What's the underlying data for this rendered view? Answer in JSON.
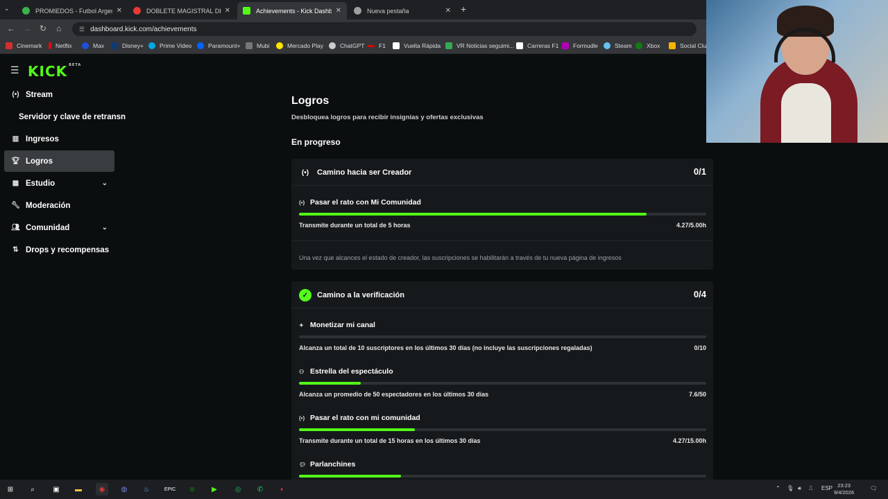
{
  "browser": {
    "tabs": [
      {
        "title": "PROMIEDOS - Futbol Argentino",
        "color": "#3bb34a"
      },
      {
        "title": "DOBLETE MAGISTRAL DE WATK",
        "color": "#e53935"
      },
      {
        "title": "Achievements - Kick Dashboard",
        "color": "#53fc18",
        "active": true
      },
      {
        "title": "Nueva pestaña",
        "color": "#9e9e9e"
      }
    ],
    "url": "dashboard.kick.com/achievements",
    "bookmarks": [
      {
        "label": "Cinemark",
        "color": "#d32f2f"
      },
      {
        "label": "Netflix",
        "color": "#e50914"
      },
      {
        "label": "Max",
        "color": "#1f4ed8"
      },
      {
        "label": "Disney+",
        "color": "#0e3b73"
      },
      {
        "label": "Prime Video",
        "color": "#00a8e1"
      },
      {
        "label": "Paramount+",
        "color": "#0064ff"
      },
      {
        "label": "Mubi",
        "color": "#777777"
      },
      {
        "label": "Mercado Play",
        "color": "#ffe600"
      },
      {
        "label": "ChatGPT",
        "color": "#cccccc"
      },
      {
        "label": "F1",
        "color": "#e10600"
      },
      {
        "label": "Vuelta Rápida",
        "color": "#ffffff"
      },
      {
        "label": "VR Noticias seguimi...",
        "color": "#34a853"
      },
      {
        "label": "Carreras F1",
        "color": "#ffffff"
      },
      {
        "label": "Formudle",
        "color": "#b000b5"
      },
      {
        "label": "Steam",
        "color": "#66c0f4"
      },
      {
        "label": "Xbox",
        "color": "#107c10"
      },
      {
        "label": "Social Club",
        "color": "#f7b500"
      }
    ]
  },
  "sidebar": {
    "logo": "KICK",
    "logo_badge": "BETA",
    "items": [
      {
        "label": "Stream",
        "icon": "broadcast-icon"
      },
      {
        "label": "Servidor y clave de retransn",
        "icon": ""
      },
      {
        "label": "Ingresos",
        "icon": "chart-icon"
      },
      {
        "label": "Logros",
        "icon": "trophy-icon",
        "active": true
      },
      {
        "label": "Estudio",
        "icon": "studio-icon",
        "chevron": true
      },
      {
        "label": "Moderación",
        "icon": "wrench-icon"
      },
      {
        "label": "Comunidad",
        "icon": "people-icon",
        "chevron": true
      },
      {
        "label": "Drops y recompensas",
        "icon": "drops-icon"
      }
    ]
  },
  "main": {
    "title": "Logros",
    "subtitle": "Desbloquea logros para recibir insignias y ofertas exclusivas",
    "section": "En progreso",
    "cards": [
      {
        "title": "Camino hacia ser Creador",
        "count": "0/1",
        "tasks": [
          {
            "title": "Pasar el rato con Mi Comunidad",
            "desc": "Transmite durante un total de 5 horas",
            "value": "4.27/5.00h",
            "progress": 0.854
          }
        ],
        "note": "Una vez que alcances el estado de creador, las suscripciones se habilitarán a través de tu nueva página de ingresos"
      },
      {
        "title": "Camino a la verificación",
        "count": "0/4",
        "tasks": [
          {
            "title": "Monetizar mi canal",
            "desc": "Alcanza un total de 10 suscriptores en los últimos 30 días (no incluye las suscripciones regaladas)",
            "value": "0/10",
            "progress": 0.0
          },
          {
            "title": "Estrella del espectáculo",
            "desc": "Alcanza un promedio de 50 espectadores en los últimos 30 días",
            "value": "7.6/50",
            "progress": 0.152
          },
          {
            "title": "Pasar el rato con mi comunidad",
            "desc": "Transmite durante un total de 15 horas en los últimos 30 días",
            "value": "4.27/15.00h",
            "progress": 0.285
          },
          {
            "title": "Parlanchines",
            "desc": "",
            "value": "",
            "progress": 0.25
          }
        ]
      }
    ]
  },
  "taskbar": {
    "lang": "ESP",
    "time": "23:23",
    "date": "9/4/2026"
  }
}
